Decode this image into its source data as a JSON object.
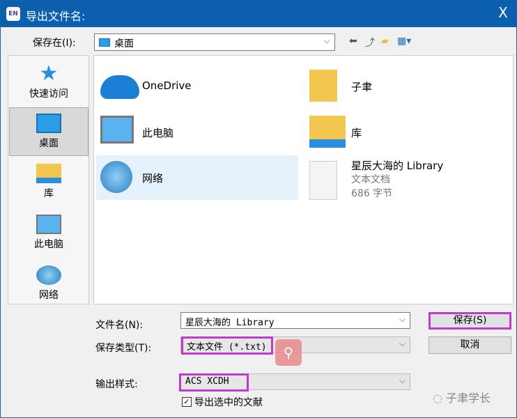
{
  "window": {
    "app_icon": "EN",
    "title": "导出文件名:",
    "close": "X"
  },
  "lookin": {
    "label": "保存在(I):",
    "value": "桌面"
  },
  "toolbar": {
    "icons": [
      "back-icon",
      "up-folder-icon",
      "new-folder-icon",
      "view-menu-icon"
    ]
  },
  "nav": [
    {
      "label": "快速访问"
    },
    {
      "label": "桌面"
    },
    {
      "label": "库"
    },
    {
      "label": "此电脑"
    },
    {
      "label": "网络"
    }
  ],
  "files": [
    {
      "name": "OneDrive"
    },
    {
      "name": "子聿"
    },
    {
      "name": "此电脑"
    },
    {
      "name": "库"
    },
    {
      "name": "网络"
    },
    {
      "name": "星辰大海的 Library",
      "type": "文本文档",
      "size": "686 字节"
    }
  ],
  "form": {
    "filename_label": "文件名(N):",
    "filename": "星辰大海的 Library",
    "type_label": "保存类型(T):",
    "type": "文本文件 (*.txt)",
    "style_label": "输出样式:",
    "style": "ACS XCDH",
    "checkbox_label": "导出选中的文献",
    "checkbox_checked": true,
    "save": "保存(S)",
    "cancel": "取消"
  },
  "watermark": "子聿学长",
  "colors": {
    "titlebar": "#0a60ae",
    "highlight": "#c13ad0"
  }
}
